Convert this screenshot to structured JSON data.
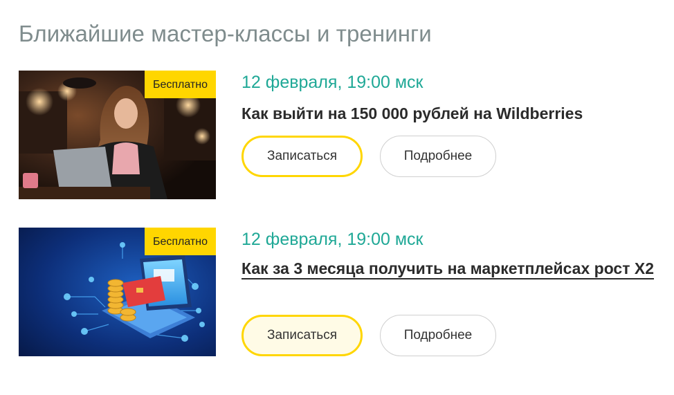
{
  "section": {
    "title": "Ближайшие мастер-классы и тренинги"
  },
  "events": [
    {
      "badge": "Бесплатно",
      "date": "12 февраля, 19:00 мск",
      "title": "Как выйти на 150 000 рублей на Wildberries",
      "primary_button": "Записаться",
      "secondary_button": "Подробнее"
    },
    {
      "badge": "Бесплатно",
      "date": "12 февраля, 19:00 мск",
      "title": "Как за 3 месяца получить на маркетплейсах рост Х2",
      "primary_button": "Записаться",
      "secondary_button": "Подробнее"
    }
  ],
  "colors": {
    "accent_teal": "#1fa896",
    "badge_yellow": "#ffd600",
    "title_gray": "#7f8c8d"
  }
}
